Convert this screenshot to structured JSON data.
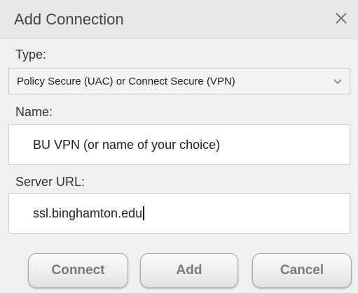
{
  "dialog": {
    "title": "Add Connection",
    "close_icon": "close-icon"
  },
  "type_field": {
    "label": "Type:",
    "selected": "Policy Secure (UAC) or Connect Secure (VPN)",
    "dropdown_icon": "chevron-down-icon"
  },
  "name_field": {
    "label": "Name:",
    "value": "BU VPN (or name of your choice)"
  },
  "server_field": {
    "label": "Server URL:",
    "value": "ssl.binghamton.edu"
  },
  "buttons": {
    "connect": "Connect",
    "add": "Add",
    "cancel": "Cancel"
  },
  "colors": {
    "dialog_background": "#f0f0f0",
    "title_bar": "#e8e8e8",
    "button_text": "#7a7a7a"
  }
}
